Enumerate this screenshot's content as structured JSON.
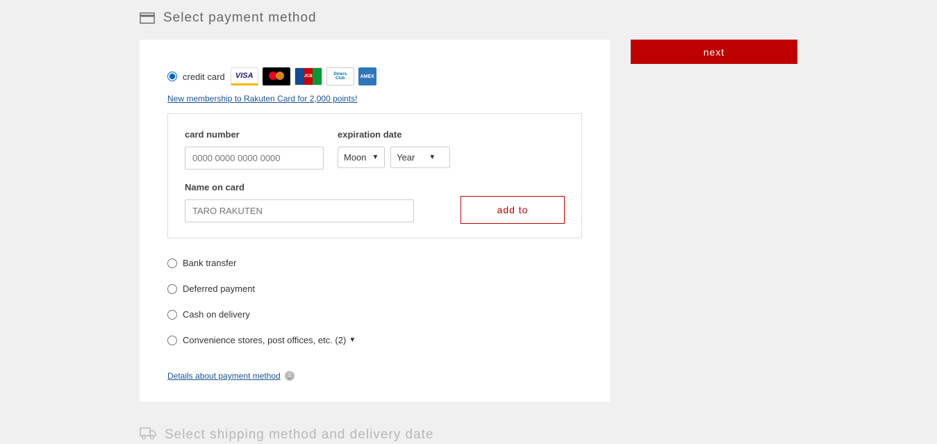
{
  "section1": {
    "title": "Select payment method"
  },
  "payment": {
    "options": {
      "credit_card": "credit card",
      "bank_transfer": "Bank transfer",
      "deferred": "Deferred payment",
      "cod": "Cash on delivery",
      "convenience": "Convenience stores, post offices, etc. (2)"
    },
    "promo_link": "New membership to Rakuten Card for 2,000 points!",
    "form": {
      "card_number_label": "card number",
      "card_number_placeholder": "0000 0000 0000 0000",
      "expiration_label": "expiration date",
      "month_select": "Moon",
      "year_select": "Year",
      "name_label": "Name on card",
      "name_placeholder": "TARO RAKUTEN",
      "add_button": "add to"
    },
    "details_link": "Details about payment method"
  },
  "next_button": "next",
  "section2": {
    "title": "Select shipping method and delivery date"
  }
}
